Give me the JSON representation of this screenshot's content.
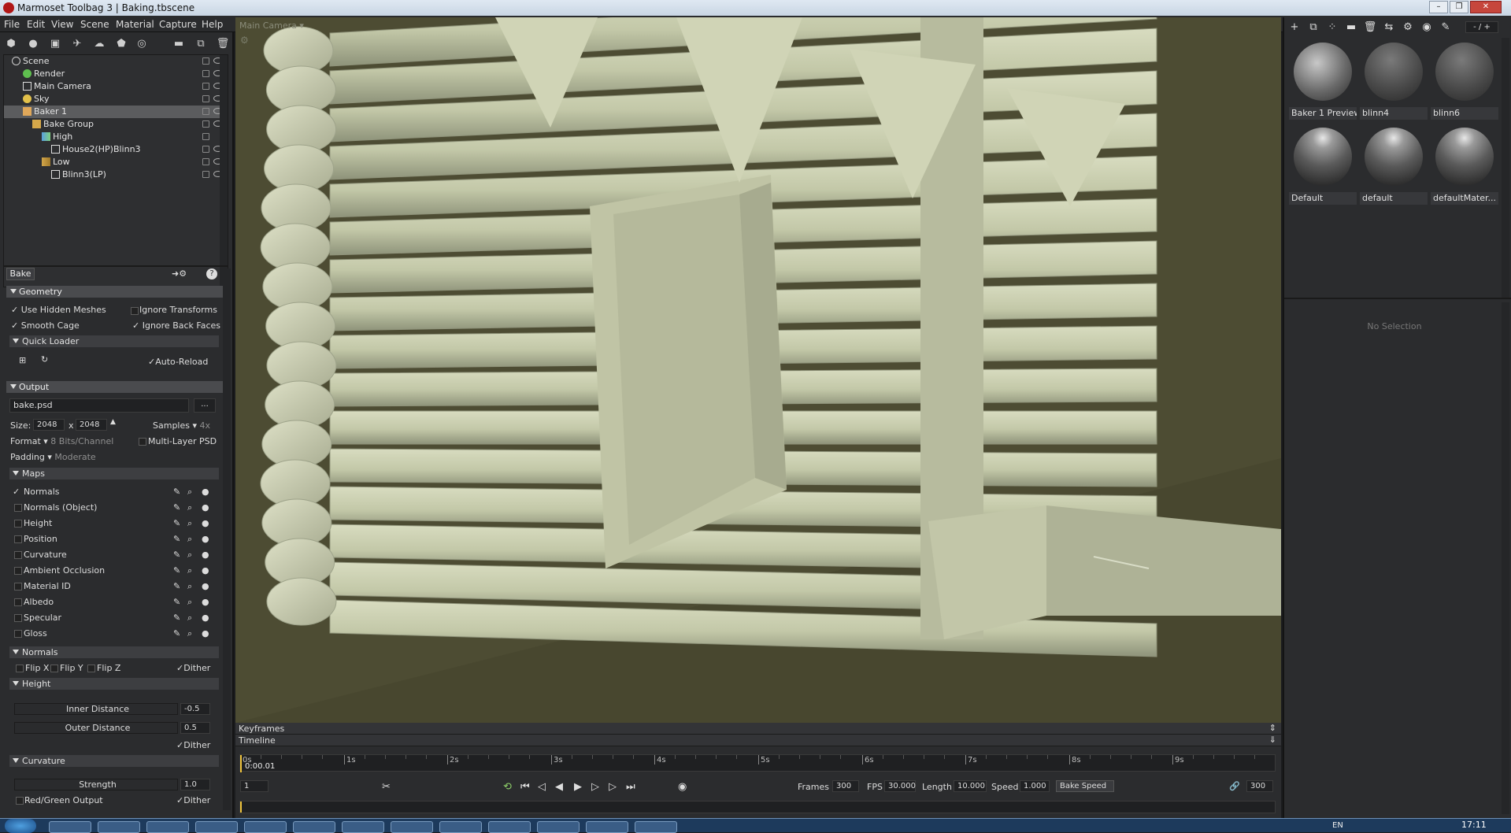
{
  "window": {
    "title": "Marmoset Toolbag 3  |  Baking.tbscene"
  },
  "menu": [
    "File",
    "Edit",
    "View",
    "Scene",
    "Material",
    "Capture",
    "Help"
  ],
  "scene_tree": [
    {
      "label": "Scene",
      "depth": 0
    },
    {
      "label": "Render",
      "depth": 1
    },
    {
      "label": "Main Camera",
      "depth": 1
    },
    {
      "label": "Sky",
      "depth": 1
    },
    {
      "label": "Baker 1",
      "depth": 1,
      "selected": true
    },
    {
      "label": "Bake Group",
      "depth": 2
    },
    {
      "label": "High",
      "depth": 3
    },
    {
      "label": "House2(HP)Blinn3",
      "depth": 4
    },
    {
      "label": "Low",
      "depth": 3
    },
    {
      "label": "Blinn3(LP)",
      "depth": 4
    }
  ],
  "bake_panel": {
    "tab": "Bake",
    "geometry": {
      "title": "Geometry",
      "use_hidden": "Use Hidden Meshes",
      "ignore_transforms": "Ignore Transforms",
      "smooth_cage": "Smooth Cage",
      "ignore_back": "Ignore Back Faces"
    },
    "quick_loader": {
      "title": "Quick Loader",
      "auto_reload": "Auto-Reload"
    },
    "output": {
      "title": "Output",
      "file": "bake.psd",
      "browse": "...",
      "size_label": "Size:",
      "width": "2048",
      "x": "x",
      "height": "2048",
      "samples_label": "Samples",
      "samples_value": "4x",
      "format_label": "Format",
      "format_value": "8 Bits/Channel",
      "multilayer": "Multi-Layer PSD",
      "padding_label": "Padding",
      "padding_value": "Moderate"
    },
    "maps": {
      "title": "Maps",
      "items": [
        "Normals",
        "Normals (Object)",
        "Height",
        "Position",
        "Curvature",
        "Ambient Occlusion",
        "Material ID",
        "Albedo",
        "Specular",
        "Gloss"
      ]
    },
    "normals": {
      "title": "Normals",
      "flip_x": "Flip X",
      "flip_y": "Flip Y",
      "flip_z": "Flip Z",
      "dither": "Dither"
    },
    "height": {
      "title": "Height",
      "inner": "Inner Distance",
      "inner_val": "-0.5",
      "outer": "Outer Distance",
      "outer_val": "0.5",
      "dither": "Dither"
    },
    "curvature": {
      "title": "Curvature",
      "strength": "Strength",
      "strength_val": "1.0",
      "rg": "Red/Green Output",
      "dither": "Dither"
    }
  },
  "viewport": {
    "camera": "Main Camera"
  },
  "timeline": {
    "keyframes": "Keyframes",
    "timeline": "Timeline",
    "ticks": [
      "0s",
      "1s",
      "2s",
      "3s",
      "4s",
      "5s",
      "6s",
      "7s",
      "8s",
      "9s"
    ],
    "current": "0:00.01",
    "frame": "1",
    "frames_label": "Frames",
    "frames": "300",
    "fps_label": "FPS",
    "fps": "30.000",
    "length_label": "Length",
    "length": "10.000",
    "speed_label": "Speed",
    "speed": "1.000",
    "bake_speed": "Bake Speed",
    "end_frame": "300"
  },
  "materials": [
    {
      "name": "Baker 1 Preview",
      "style": "textured"
    },
    {
      "name": "blinn4",
      "style": "matte"
    },
    {
      "name": "blinn6",
      "style": "matte"
    },
    {
      "name": "Default",
      "style": "glossy"
    },
    {
      "name": "default",
      "style": "glossy"
    },
    {
      "name": "defaultMater...",
      "style": "glossy"
    }
  ],
  "right_panel": {
    "zoom": "- / +",
    "no_selection": "No Selection"
  },
  "taskbar": {
    "lang": "EN",
    "time": "17:11"
  }
}
